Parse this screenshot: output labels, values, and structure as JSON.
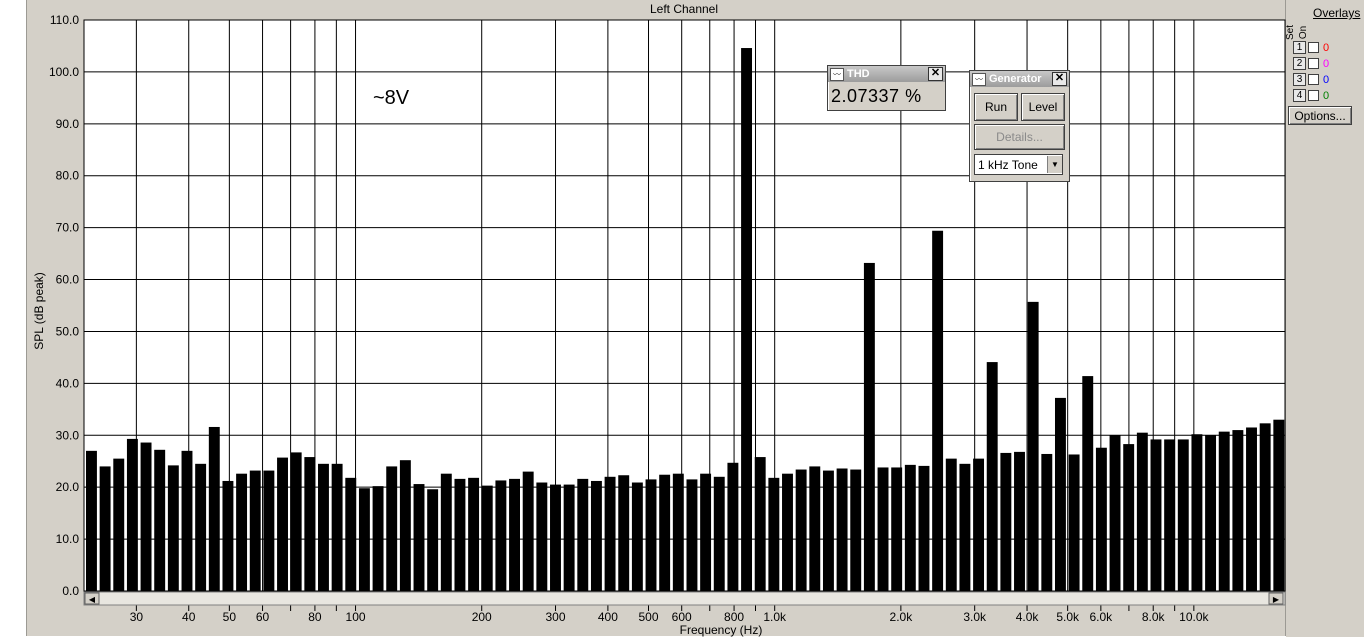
{
  "chart_data": {
    "type": "bar",
    "title": "Left Channel",
    "xlabel": "Frequency (Hz)",
    "ylabel": "SPL (dB peak)",
    "ylim": [
      0,
      110
    ],
    "y_ticks": [
      "0.0",
      "10.0",
      "20.0",
      "30.0",
      "40.0",
      "50.0",
      "60.0",
      "70.0",
      "80.0",
      "90.0",
      "100.0",
      "110.0"
    ],
    "x_scale": "log",
    "x_ticks": [
      {
        "value": 30,
        "label": "30"
      },
      {
        "value": 40,
        "label": "40"
      },
      {
        "value": 50,
        "label": "50"
      },
      {
        "value": 60,
        "label": "60"
      },
      {
        "value": 70,
        "label": ""
      },
      {
        "value": 80,
        "label": "80"
      },
      {
        "value": 90,
        "label": ""
      },
      {
        "value": 100,
        "label": "100"
      },
      {
        "value": 200,
        "label": "200"
      },
      {
        "value": 300,
        "label": "300"
      },
      {
        "value": 400,
        "label": "400"
      },
      {
        "value": 500,
        "label": "500"
      },
      {
        "value": 600,
        "label": "600"
      },
      {
        "value": 700,
        "label": ""
      },
      {
        "value": 800,
        "label": "800"
      },
      {
        "value": 900,
        "label": ""
      },
      {
        "value": 1000,
        "label": "1.0k"
      },
      {
        "value": 2000,
        "label": "2.0k"
      },
      {
        "value": 3000,
        "label": "3.0k"
      },
      {
        "value": 4000,
        "label": "4.0k"
      },
      {
        "value": 5000,
        "label": "5.0k"
      },
      {
        "value": 6000,
        "label": "6.0k"
      },
      {
        "value": 7000,
        "label": ""
      },
      {
        "value": 8000,
        "label": "8.0k"
      },
      {
        "value": 9000,
        "label": ""
      },
      {
        "value": 10000,
        "label": "10.0k"
      }
    ],
    "grid": true,
    "annotation": "~8V",
    "values": [
      27.0,
      24.0,
      25.5,
      29.3,
      28.6,
      27.2,
      24.2,
      27.0,
      24.5,
      31.6,
      21.2,
      22.6,
      23.2,
      23.2,
      25.7,
      26.7,
      25.8,
      24.5,
      24.5,
      21.8,
      19.8,
      20.2,
      24.0,
      25.2,
      20.6,
      19.6,
      22.6,
      21.6,
      21.8,
      20.3,
      21.3,
      21.6,
      23.0,
      20.9,
      20.5,
      20.5,
      21.6,
      21.2,
      22.0,
      22.3,
      20.9,
      21.5,
      22.4,
      22.6,
      21.5,
      22.6,
      22.0,
      24.7,
      104.6,
      25.8,
      21.8,
      22.6,
      23.4,
      24.0,
      23.2,
      23.6,
      23.4,
      63.2,
      23.8,
      23.8,
      24.3,
      24.1,
      69.4,
      25.5,
      24.5,
      25.5,
      44.1,
      26.6,
      26.8,
      55.7,
      26.4,
      37.2,
      26.3,
      41.4,
      27.6,
      30.0,
      28.3,
      30.5,
      29.2,
      29.2,
      29.2,
      30.2,
      30.0,
      30.7,
      31.0,
      31.5,
      32.3,
      33.0
    ]
  },
  "thd_window": {
    "title": "THD",
    "value": "2.07337 %",
    "close_glyph": "✕"
  },
  "generator_window": {
    "title": "Generator",
    "close_glyph": "✕",
    "run_label": "Run",
    "level_label": "Level",
    "details_label": "Details...",
    "tone_select": "1 kHz Tone"
  },
  "overlays": {
    "header": "Overlays",
    "set_label": "Set",
    "on_label": "On",
    "rows": [
      {
        "num": "1",
        "value": "0",
        "color": "#ff0000"
      },
      {
        "num": "2",
        "value": "0",
        "color": "#ff00ff"
      },
      {
        "num": "3",
        "value": "0",
        "color": "#0000ff"
      },
      {
        "num": "4",
        "value": "0",
        "color": "#008000"
      }
    ],
    "options_label": "Options..."
  },
  "scrollbar": {
    "left_arrow": "◀",
    "right_arrow": "▶"
  }
}
